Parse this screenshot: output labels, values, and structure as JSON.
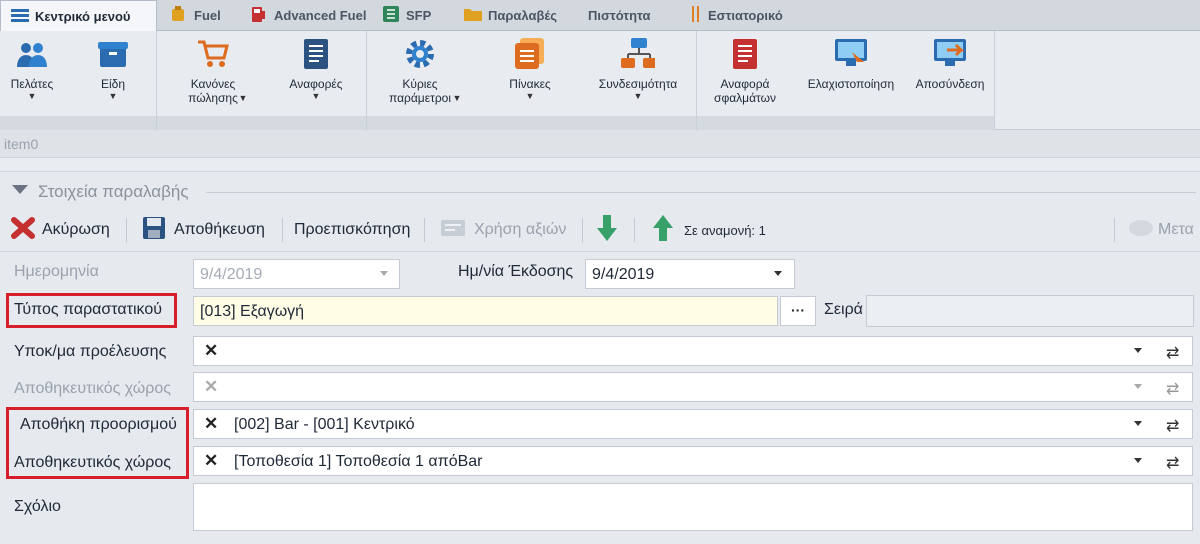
{
  "tabs": [
    {
      "label": "Κεντρικό μενού",
      "icon": "menu-icon",
      "active": true
    },
    {
      "label": "Fuel",
      "icon": "fuel-icon"
    },
    {
      "label": "Advanced Fuel",
      "icon": "fuel-pump-icon"
    },
    {
      "label": "SFP",
      "icon": "spreadsheet-icon"
    },
    {
      "label": "Παραλαβές",
      "icon": "folder-icon"
    },
    {
      "label": "Πιστότητα",
      "icon": ""
    },
    {
      "label": "Εστιατορικό",
      "icon": "cutlery-icon"
    }
  ],
  "ribbon": {
    "buttons": [
      {
        "label": "Πελάτες",
        "icon": "customers-icon"
      },
      {
        "label": "Είδη",
        "icon": "items-box-icon"
      },
      {
        "label": "Κανόνες πώλησης",
        "icon": "cart-icon"
      },
      {
        "label": "Αναφορές",
        "icon": "reports-icon"
      },
      {
        "label": "Κύριες παράμετροι",
        "icon": "gear-icon"
      },
      {
        "label": "Πίνακες",
        "icon": "tables-icon"
      },
      {
        "label": "Συνδεσιμότητα",
        "icon": "network-icon"
      },
      {
        "label": "Αναφορά σφαλμάτων",
        "icon": "error-report-icon"
      },
      {
        "label": "Ελαχιστοποίηση",
        "icon": "minimize-icon"
      },
      {
        "label": "Αποσύνδεση",
        "icon": "logout-icon"
      }
    ]
  },
  "item0": "item0",
  "section_title": "Στοιχεία παραλαβής",
  "toolbar": {
    "cancel": "Ακύρωση",
    "save": "Αποθήκευση",
    "preview": "Προεπισκόπηση",
    "use_values": "Χρήση αξιών",
    "pending": "Σε αναμονή: 1",
    "more": "Μετα"
  },
  "form": {
    "date_label": "Ημερομηνία",
    "date_value": "9/4/2019",
    "issue_date_label": "Ημ/νία Έκδοσης",
    "issue_date_value": "9/4/2019",
    "doc_type_label": "Τύπος παραστατικού",
    "doc_type_value": "[013] Εξαγωγή",
    "doc_type_btn": "···",
    "series_label": "Σειρά",
    "origin_branch_label": "Υποκ/μα προέλευσης",
    "origin_storage_label": "Αποθηκευτικός χώρος",
    "dest_warehouse_label": "Αποθήκη προορισμού",
    "dest_warehouse_value": "[002] Bar - [001] Κεντρικό",
    "dest_storage_label": "Αποθηκευτικός χώρος",
    "dest_storage_value": "[Τοποθεσία 1] Τοποθεσία 1 απόBar",
    "comment_label": "Σχόλιο",
    "clear_symbol": "✕",
    "refresh_symbol": "⇄"
  },
  "colors": {
    "highlight": "#d61f2b",
    "field_yellow": "#fffde6"
  }
}
